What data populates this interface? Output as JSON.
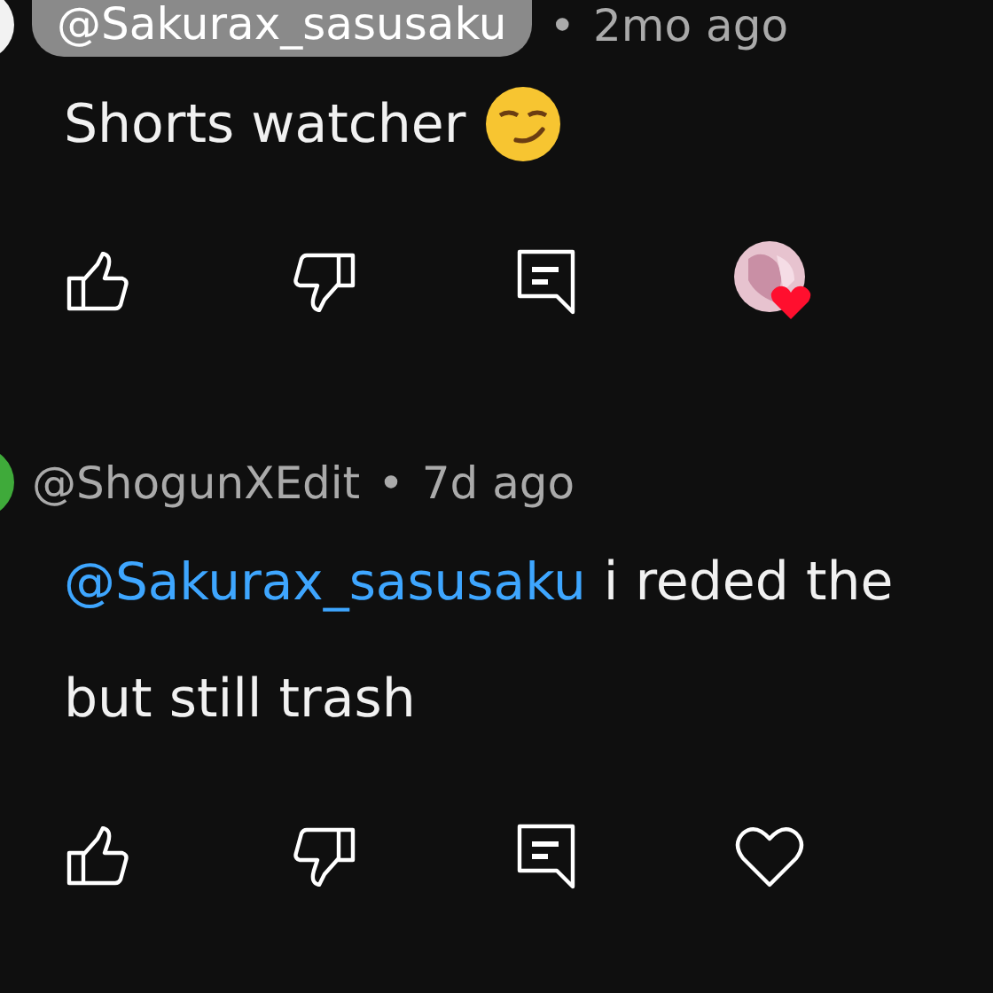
{
  "comments": [
    {
      "author": "@Sakurax_sasusaku",
      "author_highlighted": true,
      "separator": "•",
      "time": "2mo ago",
      "lines": [
        "Shorts watcher"
      ],
      "emoji": true,
      "creator_hearted": true,
      "color": "#f2f2f2"
    },
    {
      "author": "@ShogunXEdit",
      "author_highlighted": false,
      "separator": "•",
      "time": "7d ago",
      "mention": "@Sakurax_sasusaku",
      "lines": [
        "i reded the",
        "but still trash"
      ],
      "emoji": false,
      "creator_hearted": false,
      "color": "#3faa3a"
    }
  ]
}
